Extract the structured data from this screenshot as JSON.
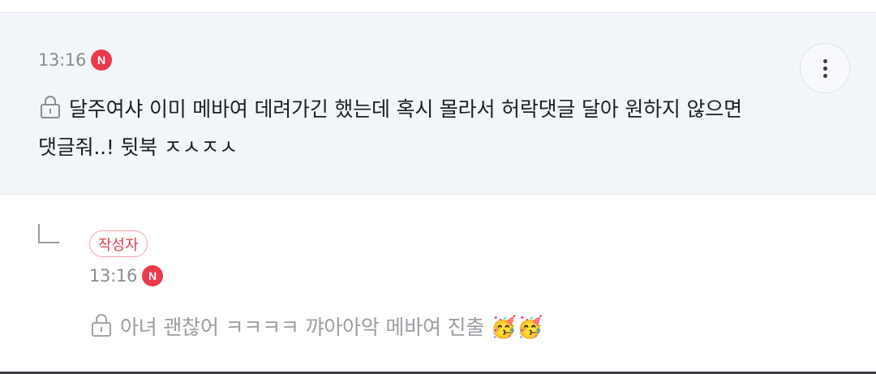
{
  "comment": {
    "time": "13:16",
    "new_badge": "N",
    "line1": "달주여샤 이미 메바여 데려가긴 했는데 혹시 몰라서 허락댓글 달아 원하지 않으면",
    "line2": "댓글줘..! 뒷북 ㅈㅅㅈㅅ",
    "locked": true,
    "more_icon": "more-vertical-icon"
  },
  "reply": {
    "author_badge": "작성자",
    "time": "13:16",
    "new_badge": "N",
    "text": "아녀 괜찮어 ㅋㅋㅋㅋ 꺄아아악 메바여 진출",
    "emojis": "🥳🥳",
    "locked": true
  },
  "colors": {
    "comment_bg": "#f2f5fa",
    "new_badge": "#ea3b4b",
    "author_badge_text": "#e2404f"
  }
}
